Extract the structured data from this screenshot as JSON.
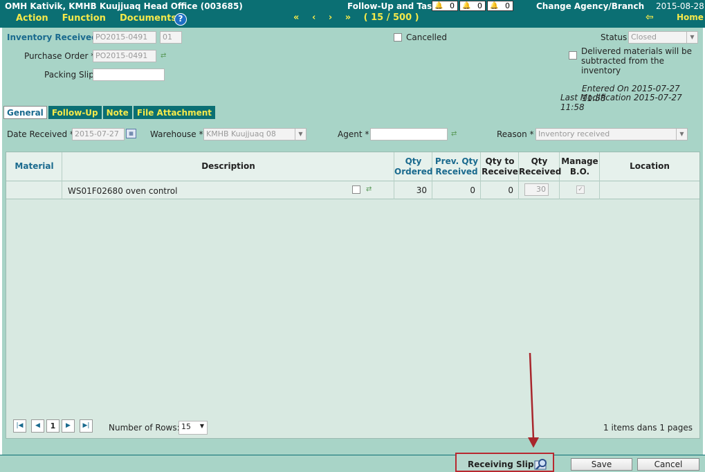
{
  "header": {
    "org": "OMH Kativik, KMHB Kuujjuaq Head Office (003685)",
    "menu": [
      "Action",
      "Function",
      "Documents"
    ],
    "help": "?",
    "nav": {
      "first": "«",
      "prev": "‹",
      "next": "›",
      "last": "»",
      "position": "( 15 / 500 )"
    },
    "follow_up_label": "Follow-Up and Task",
    "badges": [
      {
        "icon": "red-bell-icon",
        "value": "0",
        "color": "#d43a3a"
      },
      {
        "icon": "yellow-bell-icon",
        "value": "0",
        "color": "#d9a21b"
      },
      {
        "icon": "green-bell-icon",
        "value": "0",
        "color": "#3aa33a"
      }
    ],
    "change_agency": "Change Agency/Branch",
    "date": "2015-08-28",
    "home": "Home"
  },
  "form": {
    "inventory_received_label": "Inventory Received",
    "inventory_received_value": "PO2015-0491",
    "inventory_received_suffix": "01",
    "purchase_order_label": "Purchase Order *",
    "purchase_order_value": "PO2015-0491",
    "packing_slip_label": "Packing Slip",
    "packing_slip_value": "",
    "cancelled_label": "Cancelled",
    "status_label": "Status",
    "status_value": "Closed",
    "delivered_line1": "Delivered materials will be",
    "delivered_line2": "subtracted from the inventory",
    "entered_on": "Entered On 2015-07-27 11:58",
    "last_modification": "Last Modification 2015-07-27 11:58"
  },
  "tabs": [
    "General",
    "Follow-Up",
    "Note",
    "File Attachment"
  ],
  "general": {
    "date_received_label": "Date Received *",
    "date_received_value": "2015-07-27",
    "warehouse_label": "Warehouse *",
    "warehouse_value": "KMHB Kuujjuaq 08",
    "agent_label": "Agent *",
    "agent_value": "",
    "reason_label": "Reason *",
    "reason_value": "Inventory received"
  },
  "grid": {
    "columns": {
      "material": "Material",
      "description": "Description",
      "qty_ordered": [
        "Qty",
        "Ordered"
      ],
      "prev_qty": [
        "Prev. Qty",
        "Received"
      ],
      "qty_to_receive": [
        "Qty to",
        "Receive"
      ],
      "qty_received": [
        "Qty",
        "Received"
      ],
      "manage_bo": [
        "Manage",
        "B.O."
      ],
      "location": "Location"
    },
    "rows": [
      {
        "material": "",
        "description": "WS01F02680 oven control",
        "qty_ordered": "30",
        "prev_qty": "0",
        "qty_to_receive": "0",
        "qty_received": "30",
        "location": ""
      }
    ],
    "pager": {
      "first": "|◀",
      "prev": "◀",
      "page": "1",
      "next": "▶",
      "last": "▶|"
    },
    "rows_label": "Number of Rows:",
    "rows_value": "15",
    "summary": "1 items dans 1 pages"
  },
  "footer": {
    "receiving_slip": "Receiving Slip",
    "save": "Save",
    "cancel": "Cancel"
  },
  "colors": {
    "header": "#0b6f73",
    "menu": "#f5e94a",
    "panel": "#a8d4c7",
    "highlight": "#b8282f"
  }
}
